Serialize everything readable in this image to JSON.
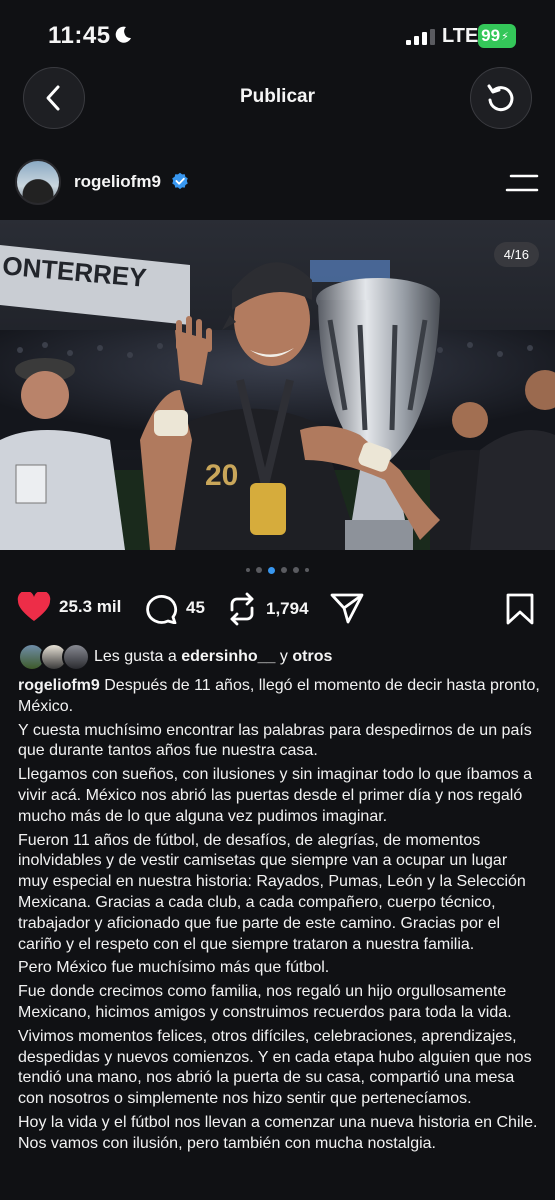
{
  "status_bar": {
    "time": "11:45",
    "network": "LTE",
    "battery": "99"
  },
  "header": {
    "title": "Publicar"
  },
  "post": {
    "username": "rogeliofm9",
    "image_counter": "4/16",
    "image_alt": "ONTERREY",
    "likes_count": "25.3 mil",
    "comments_count": "45",
    "reposts_count": "1,794",
    "liked_by": {
      "prefix": "Les gusta a",
      "user": "edersinho__",
      "joiner": "y",
      "others": "otros"
    },
    "caption_username": "rogeliofm9",
    "caption": [
      "Después de 11 años, llegó el momento de decir hasta pronto, México.",
      "Y cuesta muchísimo encontrar las palabras para despedirnos de un país que durante tantos años fue nuestra casa.",
      "Llegamos con sueños, con ilusiones y sin imaginar todo lo que íbamos a vivir acá. México nos abrió las puertas desde el primer día y nos regaló mucho más de lo que alguna vez pudimos imaginar.",
      "Fueron 11 años de fútbol, de desafíos, de alegrías, de momentos inolvidables y de vestir camisetas que siempre van a ocupar un lugar muy especial en nuestra historia: Rayados, Pumas, León y la Selección Mexicana. Gracias a cada club, a cada compañero, cuerpo técnico, trabajador y aficionado que fue parte de este camino. Gracias por el cariño y el respeto con el que siempre trataron a nuestra familia.",
      "Pero México fue muchísimo más que fútbol.",
      "Fue donde crecimos como familia, nos regaló un hijo orgullosamente Mexicano, hicimos amigos y construimos recuerdos para toda la vida.",
      "Vivimos momentos felices, otros difíciles, celebraciones, aprendizajes, despedidas y nuevos comienzos. Y en cada etapa hubo alguien que nos tendió una mano, nos abrió la puerta de su casa, compartió una mesa con nosotros o simplemente nos hizo sentir que pertenecíamos.",
      "Hoy la vida y el fútbol nos llevan a comenzar una nueva historia en Chile. Nos vamos con ilusión, pero también con mucha nostalgia."
    ],
    "jersey_number": "20"
  },
  "colors": {
    "accent": "#3897f0",
    "like": "#ed2d48",
    "verified": "#3897f0",
    "battery": "#34c759",
    "background": "#101114"
  },
  "icons": [
    "moon-icon",
    "signal-icon",
    "back-arrow-icon",
    "refresh-icon",
    "verified-icon",
    "menu-icon",
    "heart-icon",
    "comment-icon",
    "repost-icon",
    "share-icon",
    "bookmark-icon"
  ]
}
